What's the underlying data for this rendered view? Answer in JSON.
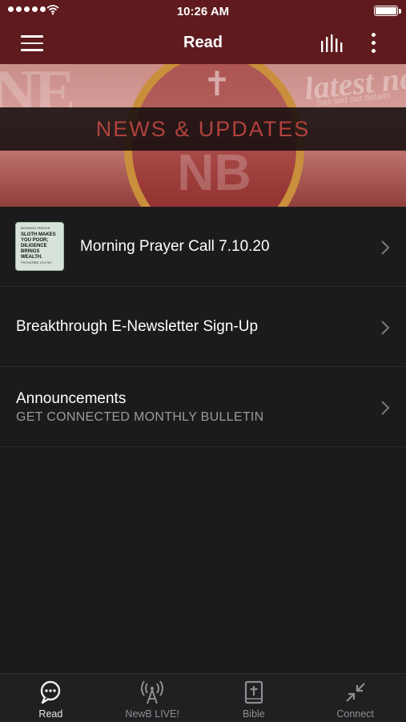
{
  "status_bar": {
    "time": "10:26 AM"
  },
  "nav": {
    "title": "Read"
  },
  "banner": {
    "label": "NEWS & UPDATES",
    "watermark_left": "NE",
    "watermark_right": "latest ne",
    "watermark_small": "has laid out details",
    "logo_text": "NB"
  },
  "list": {
    "items": [
      {
        "title": "Morning Prayer Call 7.10.20",
        "thumbnail_text": {
          "small": "MORNING PRAYER",
          "headline": "SLOTH MAKES YOU POOR; DILIGENCE BRINGS WEALTH.",
          "footer": "PROVERBS 10:4 NIV"
        }
      },
      {
        "title": "Breakthrough E-Newsletter Sign-Up"
      },
      {
        "title": "Announcements",
        "subtitle": "GET CONNECTED MONTHLY BULLETIN"
      }
    ]
  },
  "tab_bar": {
    "tabs": [
      {
        "label": "Read",
        "icon": "chat-bubble-icon",
        "active": true
      },
      {
        "label": "NewB LIVE!",
        "icon": "broadcast-antenna-icon",
        "active": false
      },
      {
        "label": "Bible",
        "icon": "bible-icon",
        "active": false
      },
      {
        "label": "Connect",
        "icon": "collapse-arrows-icon",
        "active": false
      }
    ]
  },
  "colors": {
    "header": "#5e1a1d",
    "background": "#1b1b1d",
    "banner_text": "#b2423d",
    "tab_inactive": "#8d8d90"
  }
}
